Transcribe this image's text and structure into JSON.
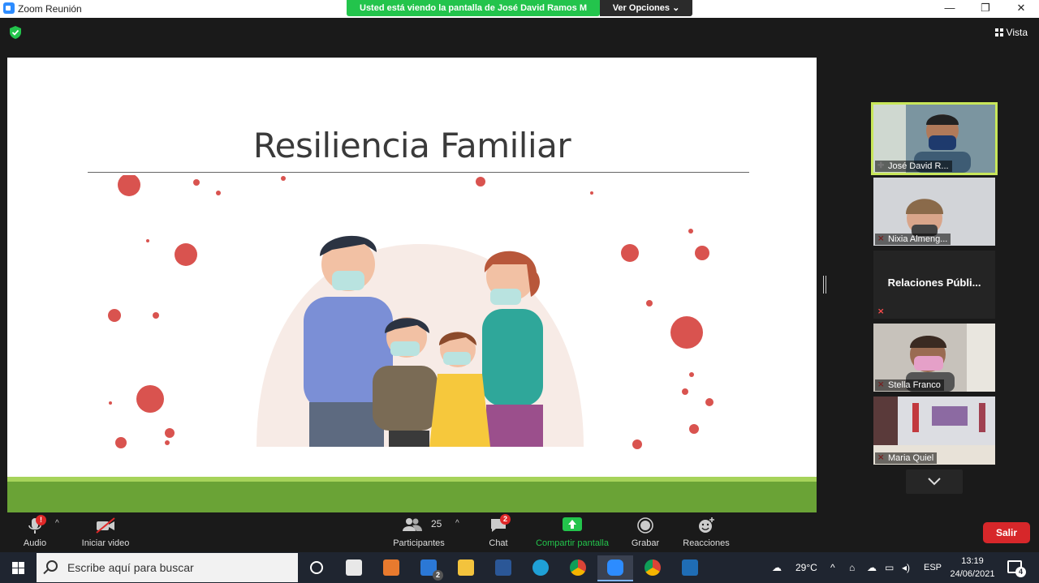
{
  "window": {
    "title": "Zoom Reunión",
    "minimize_glyph": "—",
    "restore_glyph": "❐",
    "close_glyph": "✕"
  },
  "share_banner": {
    "text": "Usted está viendo la pantalla de José David Ramos M",
    "options_label": "Ver Opciones ⌄"
  },
  "header": {
    "view_label": "Vista",
    "security_icon": "shield-check-icon"
  },
  "slide": {
    "title": "Resiliencia Familiar",
    "accent_colors": {
      "bar_light": "#a6d35a",
      "bar_dark": "#6aa336",
      "virus": "#d9534f"
    }
  },
  "participants": [
    {
      "name": "José David R...",
      "muted": false,
      "active_speaker": true
    },
    {
      "name": "Nixia Almeng...",
      "muted": true
    },
    {
      "name": "Relaciones Públi...",
      "muted": true,
      "video_off": true
    },
    {
      "name": "Stella Franco",
      "muted": true
    },
    {
      "name": "Maria Quiel",
      "muted": true
    }
  ],
  "toolbar": {
    "audio": {
      "label": "Audio",
      "badge": "!"
    },
    "video": {
      "label": "Iniciar video"
    },
    "participants": {
      "label": "Participantes",
      "count": "25"
    },
    "chat": {
      "label": "Chat",
      "badge": "2"
    },
    "share": {
      "label": "Compartir pantalla",
      "color": "#23c44c"
    },
    "record": {
      "label": "Grabar"
    },
    "reactions": {
      "label": "Reacciones"
    },
    "leave": {
      "label": "Salir",
      "color": "#d7272a"
    }
  },
  "taskbar": {
    "search_placeholder": "Escribe aquí para buscar",
    "mail_badge": "2",
    "temperature": "29°C",
    "language": "ESP",
    "time": "13:19",
    "date": "24/06/2021",
    "notifications": "4",
    "apps": [
      "cortana-icon",
      "store-icon",
      "media-player-icon",
      "mail-icon",
      "file-explorer-icon",
      "word-icon",
      "edge-icon",
      "chrome-icon",
      "zoom-icon",
      "chrome-icon",
      "photos-icon"
    ]
  }
}
